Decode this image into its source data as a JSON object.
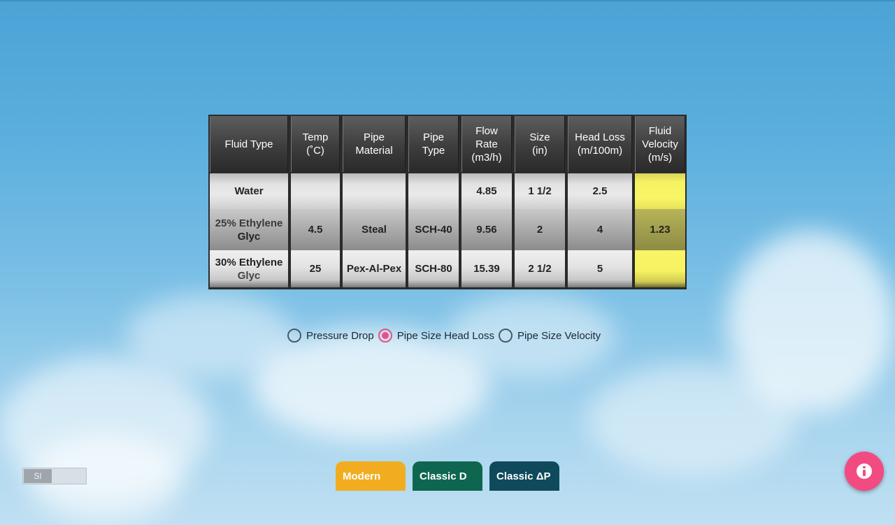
{
  "table": {
    "headers": [
      [
        "Fluid Type"
      ],
      [
        "Temp",
        "(˚C)"
      ],
      [
        "Pipe",
        "Material"
      ],
      [
        "Pipe",
        "Type"
      ],
      [
        "Flow",
        "Rate",
        "(m3/h)"
      ],
      [
        "Size",
        "(in)"
      ],
      [
        "Head Loss",
        "(m/100m)"
      ],
      [
        "Fluid",
        "Velocity",
        "(m/s)"
      ]
    ],
    "rows": [
      {
        "fluid": [
          "Water",
          ""
        ],
        "temp": "",
        "material": "",
        "pipe_type": "",
        "flow_rate": "4.85",
        "size": "1 1/2",
        "head_loss": "2.5",
        "velocity": ""
      },
      {
        "fluid": [
          "25% Ethylene",
          "Glyc"
        ],
        "temp": "4.5",
        "material": "Steal",
        "pipe_type": "SCH-40",
        "flow_rate": "9.56",
        "size": "2",
        "head_loss": "4",
        "velocity": "1.23"
      },
      {
        "fluid": [
          "30% Ethylene",
          "Glyc"
        ],
        "temp": "25",
        "material": "Pex-Al-Pex",
        "pipe_type": "SCH-80",
        "flow_rate": "15.39",
        "size": "2 1/2",
        "head_loss": "5",
        "velocity": ""
      }
    ],
    "colors": {
      "result_column": "#f6f362",
      "header_bg": "#3d3d3d"
    }
  },
  "modes": {
    "options": [
      "Pressure Drop",
      "Pipe Size Head Loss",
      "Pipe Size Velocity"
    ],
    "selected": "Pipe Size Head Loss"
  },
  "unit_toggle": {
    "label": "SI"
  },
  "tabs": {
    "modern": "Modern",
    "classic_d": "Classic D",
    "classic_dp": "Classic ΔP",
    "colors": {
      "modern": "#f1ad1f",
      "classic_d": "#0f6650",
      "classic_dp": "#0e4a5c"
    }
  },
  "fab": {
    "icon": "info-icon",
    "color": "#f24b82"
  }
}
